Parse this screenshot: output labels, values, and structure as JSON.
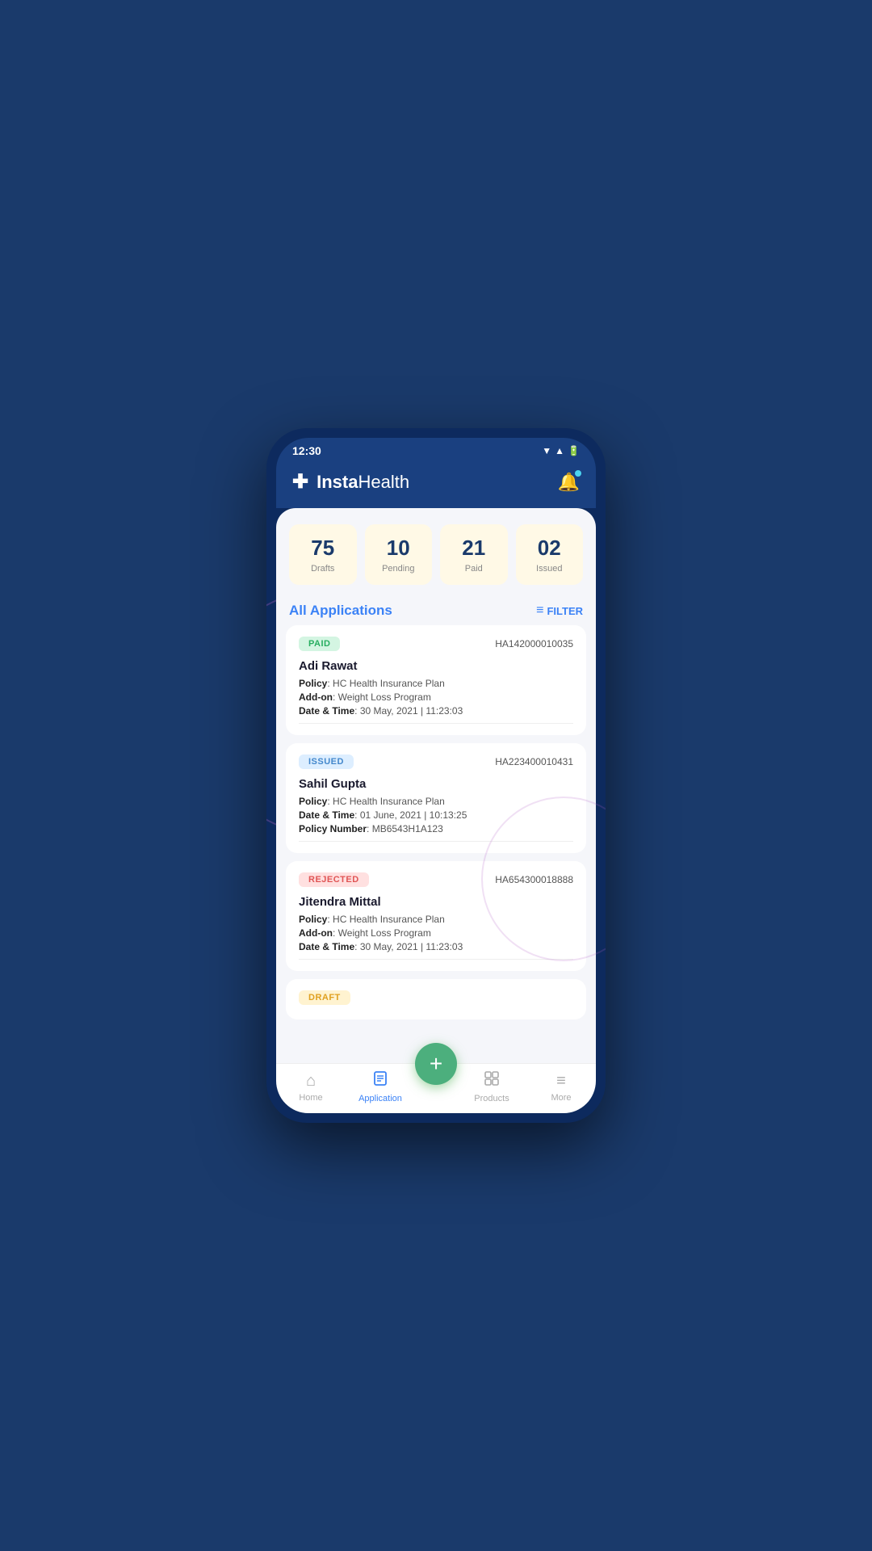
{
  "statusBar": {
    "time": "12:30"
  },
  "header": {
    "logoTextBold": "Insta",
    "logoTextLight": "Health"
  },
  "stats": [
    {
      "number": "75",
      "label": "Drafts"
    },
    {
      "number": "10",
      "label": "Pending"
    },
    {
      "number": "21",
      "label": "Paid"
    },
    {
      "number": "02",
      "label": "Issued"
    }
  ],
  "sectionTitle": "All Applications",
  "filterLabel": "FILTER",
  "applications": [
    {
      "badge": "PAID",
      "badgeClass": "badge-paid",
      "ref": "HA142000010035",
      "name": "Adi Rawat",
      "policy": "HC Health Insurance Plan",
      "addon": "Weight Loss Program",
      "datetime": "30 May, 2021  |  11:23:03",
      "policyNumber": null
    },
    {
      "badge": "ISSUED",
      "badgeClass": "badge-issued",
      "ref": "HA223400010431",
      "name": "Sahil Gupta",
      "policy": "HC Health Insurance Plan",
      "addon": null,
      "datetime": "01 June, 2021  |  10:13:25",
      "policyNumber": "MB6543H1A123"
    },
    {
      "badge": "REJECTED",
      "badgeClass": "badge-rejected",
      "ref": "HA654300018888",
      "name": "Jitendra Mittal",
      "policy": "HC Health Insurance Plan",
      "addon": "Weight Loss Program",
      "datetime": "30 May, 2021  |  11:23:03",
      "policyNumber": null
    },
    {
      "badge": "DRAFT",
      "badgeClass": "badge-draft",
      "ref": "",
      "name": "",
      "policy": "",
      "addon": null,
      "datetime": "",
      "policyNumber": null
    }
  ],
  "bottomNav": [
    {
      "label": "Home",
      "icon": "🏠",
      "active": false
    },
    {
      "label": "Application",
      "icon": "📄",
      "active": true
    },
    {
      "label": "Products",
      "icon": "📋",
      "active": false
    },
    {
      "label": "More",
      "icon": "☰",
      "active": false
    }
  ],
  "labels": {
    "policy": "Policy",
    "addon": "Add-on",
    "datetime": "Date & Time",
    "policyNumber": "Policy Number"
  }
}
